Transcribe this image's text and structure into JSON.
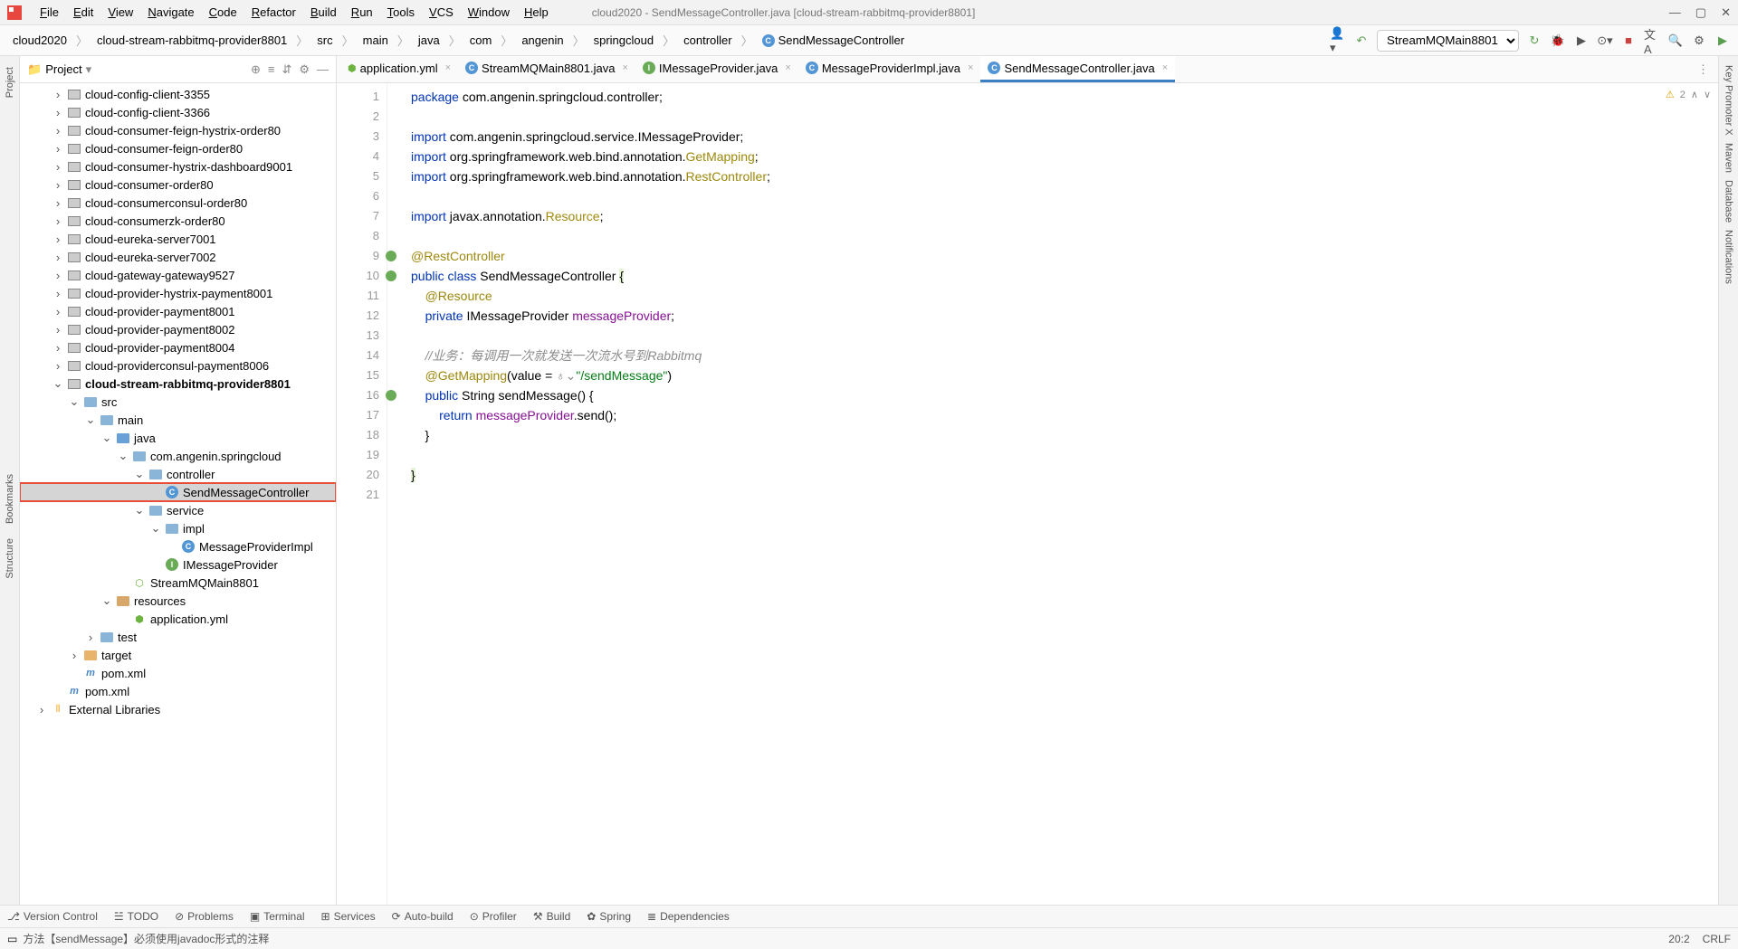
{
  "window": {
    "title": "cloud2020 - SendMessageController.java [cloud-stream-rabbitmq-provider8801]"
  },
  "menu": [
    "File",
    "Edit",
    "View",
    "Navigate",
    "Code",
    "Refactor",
    "Build",
    "Run",
    "Tools",
    "VCS",
    "Window",
    "Help"
  ],
  "breadcrumb": [
    "cloud2020",
    "cloud-stream-rabbitmq-provider8801",
    "src",
    "main",
    "java",
    "com",
    "angenin",
    "springcloud",
    "controller",
    "SendMessageController"
  ],
  "runConfig": "StreamMQMain8801",
  "projectPanel": {
    "title": "Project"
  },
  "tree": [
    {
      "d": 2,
      "a": ">",
      "i": "mod",
      "t": "cloud-config-client-3355"
    },
    {
      "d": 2,
      "a": ">",
      "i": "mod",
      "t": "cloud-config-client-3366"
    },
    {
      "d": 2,
      "a": ">",
      "i": "mod",
      "t": "cloud-consumer-feign-hystrix-order80"
    },
    {
      "d": 2,
      "a": ">",
      "i": "mod",
      "t": "cloud-consumer-feign-order80"
    },
    {
      "d": 2,
      "a": ">",
      "i": "mod",
      "t": "cloud-consumer-hystrix-dashboard9001"
    },
    {
      "d": 2,
      "a": ">",
      "i": "mod",
      "t": "cloud-consumer-order80"
    },
    {
      "d": 2,
      "a": ">",
      "i": "mod",
      "t": "cloud-consumerconsul-order80"
    },
    {
      "d": 2,
      "a": ">",
      "i": "mod",
      "t": "cloud-consumerzk-order80"
    },
    {
      "d": 2,
      "a": ">",
      "i": "mod",
      "t": "cloud-eureka-server7001"
    },
    {
      "d": 2,
      "a": ">",
      "i": "mod",
      "t": "cloud-eureka-server7002"
    },
    {
      "d": 2,
      "a": ">",
      "i": "mod",
      "t": "cloud-gateway-gateway9527"
    },
    {
      "d": 2,
      "a": ">",
      "i": "mod",
      "t": "cloud-provider-hystrix-payment8001"
    },
    {
      "d": 2,
      "a": ">",
      "i": "mod",
      "t": "cloud-provider-payment8001"
    },
    {
      "d": 2,
      "a": ">",
      "i": "mod",
      "t": "cloud-provider-payment8002"
    },
    {
      "d": 2,
      "a": ">",
      "i": "mod",
      "t": "cloud-provider-payment8004"
    },
    {
      "d": 2,
      "a": ">",
      "i": "mod",
      "t": "cloud-providerconsul-payment8006"
    },
    {
      "d": 2,
      "a": "v",
      "i": "mod",
      "t": "cloud-stream-rabbitmq-provider8801",
      "bold": true
    },
    {
      "d": 3,
      "a": "v",
      "i": "fld",
      "t": "src"
    },
    {
      "d": 4,
      "a": "v",
      "i": "fld",
      "t": "main"
    },
    {
      "d": 5,
      "a": "v",
      "i": "fld",
      "t": "java",
      "src": true
    },
    {
      "d": 6,
      "a": "v",
      "i": "fld",
      "t": "com.angenin.springcloud"
    },
    {
      "d": 7,
      "a": "v",
      "i": "fld",
      "t": "controller"
    },
    {
      "d": 8,
      "a": "",
      "i": "cls",
      "t": "SendMessageController",
      "sel": true,
      "hl": true
    },
    {
      "d": 7,
      "a": "v",
      "i": "fld",
      "t": "service"
    },
    {
      "d": 8,
      "a": "v",
      "i": "fld",
      "t": "impl"
    },
    {
      "d": 9,
      "a": "",
      "i": "cls",
      "t": "MessageProviderImpl"
    },
    {
      "d": 8,
      "a": "",
      "i": "int",
      "t": "IMessageProvider"
    },
    {
      "d": 6,
      "a": "",
      "i": "sb",
      "t": "StreamMQMain8801"
    },
    {
      "d": 5,
      "a": "v",
      "i": "fld",
      "t": "resources",
      "res": true
    },
    {
      "d": 6,
      "a": "",
      "i": "yml",
      "t": "application.yml"
    },
    {
      "d": 4,
      "a": ">",
      "i": "fld",
      "t": "test"
    },
    {
      "d": 3,
      "a": ">",
      "i": "fld",
      "t": "target",
      "tgt": true
    },
    {
      "d": 3,
      "a": "",
      "i": "m",
      "t": "pom.xml"
    },
    {
      "d": 2,
      "a": "",
      "i": "m",
      "t": "pom.xml"
    },
    {
      "d": 1,
      "a": ">",
      "i": "lib",
      "t": "External Libraries"
    }
  ],
  "tabs": [
    {
      "icon": "yml",
      "label": "application.yml"
    },
    {
      "icon": "cls",
      "label": "StreamMQMain8801.java"
    },
    {
      "icon": "int",
      "label": "IMessageProvider.java"
    },
    {
      "icon": "cls",
      "label": "MessageProviderImpl.java"
    },
    {
      "icon": "cls",
      "label": "SendMessageController.java",
      "active": true
    }
  ],
  "code": {
    "lines": [
      {
        "n": 1,
        "html": "<span class='kw'>package</span> com.angenin.springcloud.controller;"
      },
      {
        "n": 2,
        "html": ""
      },
      {
        "n": 3,
        "html": "<span class='kw'>import</span> com.angenin.springcloud.service.IMessageProvider;"
      },
      {
        "n": 4,
        "html": "<span class='kw'>import</span> org.springframework.web.bind.annotation.<span class='ann'>GetMapping</span>;"
      },
      {
        "n": 5,
        "html": "<span class='kw'>import</span> org.springframework.web.bind.annotation.<span class='ann'>RestController</span>;"
      },
      {
        "n": 6,
        "html": ""
      },
      {
        "n": 7,
        "html": "<span class='kw'>import</span> javax.annotation.<span class='ann'>Resource</span>;"
      },
      {
        "n": 8,
        "html": ""
      },
      {
        "n": 9,
        "html": "<span class='ann'>@RestController</span>",
        "gi": "impl"
      },
      {
        "n": 10,
        "html": "<span class='kw'>public class</span> <span class='cls'>SendMessageController</span> <span class='hl'>{</span>",
        "gi": "impl"
      },
      {
        "n": 11,
        "html": "    <span class='ann'>@Resource</span>"
      },
      {
        "n": 12,
        "html": "    <span class='kw'>private</span> IMessageProvider <span class='fld'>messageProvider</span>;"
      },
      {
        "n": 13,
        "html": ""
      },
      {
        "n": 14,
        "html": "    <span class='cmt'>//业务：每调用一次就发送一次流水号到Rabbitmq</span>"
      },
      {
        "n": 15,
        "html": "    <span class='ann'>@GetMapping</span>(value = <span style='color:#888'>♁⌄</span><span class='str'>\"/sendMessage\"</span>)"
      },
      {
        "n": 16,
        "html": "    <span class='kw'>public</span> String <span class='cls'>sendMessage</span>() {",
        "gi": "impl"
      },
      {
        "n": 17,
        "html": "        <span class='kw'>return</span> <span class='fld'>messageProvider</span>.send();"
      },
      {
        "n": 18,
        "html": "    }"
      },
      {
        "n": 19,
        "html": ""
      },
      {
        "n": 20,
        "html": "<span class='hl'>}</span>"
      },
      {
        "n": 21,
        "html": ""
      }
    ]
  },
  "inspect": {
    "warn": "2"
  },
  "leftStripe": [
    "Project",
    "Bookmarks",
    "Structure"
  ],
  "rightStripe": [
    "Key Promoter X",
    "Maven",
    "Database",
    "Notifications"
  ],
  "bottomTools": [
    "Version Control",
    "TODO",
    "Problems",
    "Terminal",
    "Services",
    "Auto-build",
    "Profiler",
    "Build",
    "Spring",
    "Dependencies"
  ],
  "status": {
    "msg": "方法【sendMessage】必须使用javadoc形式的注释",
    "pos": "20:2",
    "enc": "CRLF"
  }
}
